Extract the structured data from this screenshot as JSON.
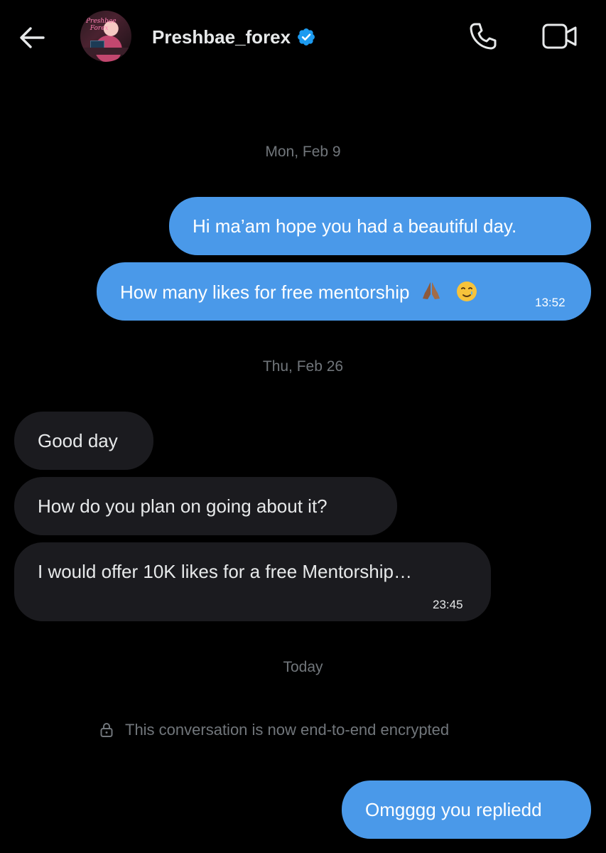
{
  "header": {
    "username": "Preshbae_forex",
    "avatar_sign_text": "Preshbae Forex"
  },
  "colors": {
    "background": "#000000",
    "outgoing_bubble": "#4a99e9",
    "incoming_bubble": "#1b1b1f",
    "verified_badge": "#1d9bf0",
    "muted_text": "#71767b"
  },
  "icons": {
    "back": "back-arrow-icon",
    "verified": "verified-badge-icon",
    "call": "phone-icon",
    "video": "video-camera-icon",
    "lock": "lock-icon"
  },
  "conversation": {
    "date_1": "Mon, Feb 9",
    "msg_out_1": "Hi ma’am hope you had a beautiful day.",
    "msg_out_2": "How many likes for free mentorship",
    "msg_out_2_time": "13:52",
    "date_2": "Thu, Feb 26",
    "msg_in_1": "Good day",
    "msg_in_2": "How do you plan on going about it?",
    "msg_in_3": "I would offer 10K likes for a free Mentorship…",
    "msg_in_3_time": "23:45",
    "date_3": "Today",
    "encryption_notice": "This conversation is now end-to-end encrypted",
    "msg_out_3": "Omgggg you repliedd"
  }
}
